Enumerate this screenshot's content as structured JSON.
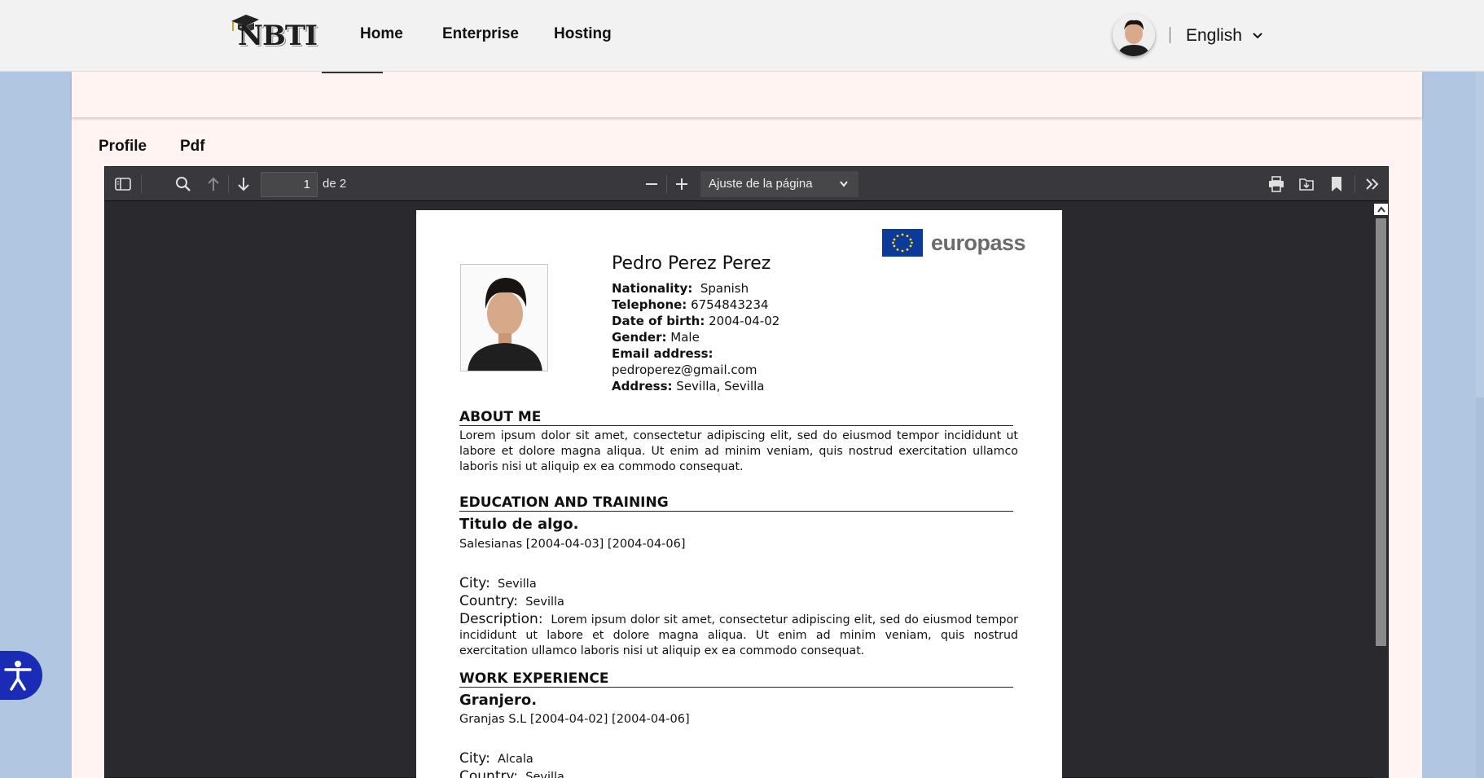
{
  "header": {
    "logo_text": "NBTI",
    "nav": [
      "Home",
      "Enterprise",
      "Hosting"
    ],
    "language": "English"
  },
  "tabs": [
    "Profile",
    "Pdf"
  ],
  "pdf_viewer": {
    "page_current": "1",
    "page_total_label": "de 2",
    "zoom_label": "Ajuste de la página"
  },
  "cv": {
    "brand": "europass",
    "name": "Pedro Perez Perez",
    "fields": {
      "nationality_label": "Nationality:",
      "nationality": "Spanish",
      "telephone_label": "Telephone:",
      "telephone": "6754843234",
      "dob_label": "Date of birth:",
      "dob": "2004-04-02",
      "gender_label": "Gender:",
      "gender": "Male",
      "email_label": "Email address:",
      "email": "pedroperez@gmail.com",
      "address_label": "Address:",
      "address": "Sevilla, Sevilla"
    },
    "about": {
      "heading": "ABOUT ME",
      "text": "Lorem ipsum dolor sit amet, consectetur adipiscing elit, sed do eiusmod tempor incididunt ut labore et dolore magna aliqua. Ut enim ad minim veniam, quis nostrud exercitation ullamco laboris nisi ut aliquip ex ea commodo consequat."
    },
    "education": {
      "heading": "EDUCATION AND TRAINING",
      "title": "Titulo de algo.",
      "sub": "Salesianas [2004-04-03]  [2004-04-06]",
      "city_label": "City:",
      "city": "Sevilla",
      "country_label": "Country:",
      "country": "Sevilla",
      "desc_label": "Description:",
      "desc": "Lorem ipsum dolor sit amet, consectetur adipiscing elit, sed do eiusmod tempor incididunt ut labore et dolore magna aliqua. Ut enim ad minim veniam, quis nostrud exercitation ullamco laboris nisi ut aliquip ex ea commodo consequat."
    },
    "work": {
      "heading": "WORK EXPERIENCE",
      "title": "Granjero.",
      "sub": "Granjas S.L [2004-04-02]  [2004-04-06]",
      "city_label": "City:",
      "city": "Alcala",
      "country_label": "Country:",
      "country": "Sevilla"
    }
  }
}
